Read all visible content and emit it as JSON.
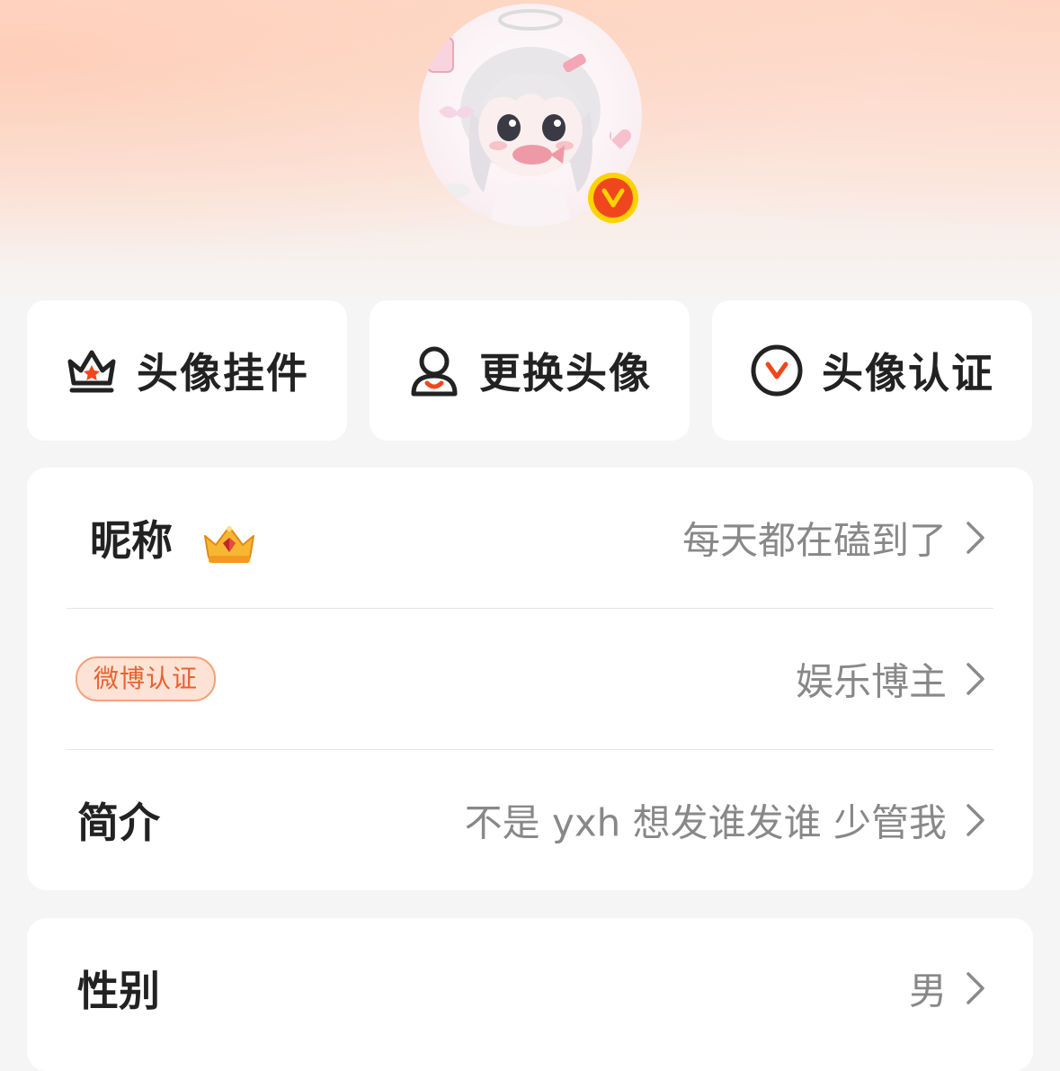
{
  "actions": [
    {
      "label": "头像挂件",
      "icon": "crown-pendant-icon"
    },
    {
      "label": "更换头像",
      "icon": "person-icon"
    },
    {
      "label": "头像认证",
      "icon": "v-verify-icon"
    }
  ],
  "profile": {
    "nickname_label": "昵称",
    "nickname_value": "每天都在磕到了",
    "verify_badge": "微博认证",
    "verify_value": "娱乐博主",
    "bio_label": "简介",
    "bio_value": "不是 yxh  想发谁发谁 少管我"
  },
  "basic": {
    "gender_label": "性别",
    "gender_value": "男"
  },
  "colors": {
    "accent": "#f0461e",
    "badge_bg": "#fde3d5",
    "badge_border": "#f5a27a",
    "gold": "#ffd200"
  }
}
